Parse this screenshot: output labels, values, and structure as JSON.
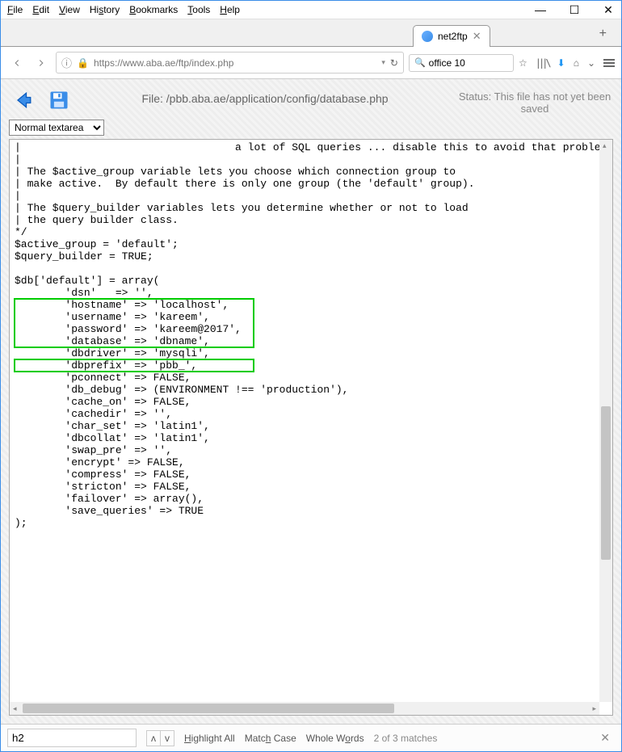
{
  "menu": {
    "file": "File",
    "edit": "Edit",
    "view": "View",
    "history": "History",
    "bookmarks": "Bookmarks",
    "tools": "Tools",
    "help": "Help"
  },
  "tab": {
    "title": "net2ftp"
  },
  "url": {
    "value": "https://www.aba.ae/ftp/index.php"
  },
  "search": {
    "value": "office 10"
  },
  "header": {
    "file_label": "File: /pbb.aba.ae/application/config/database.php",
    "status": "Status: This file has not yet been saved"
  },
  "editor": {
    "mode": "Normal textarea",
    "lines": {
      "c0": "|                                  a lot of SQL queries ... disable this to avoid that problem.",
      "c1": "|",
      "c2": "| The $active_group variable lets you choose which connection group to",
      "c3": "| make active.  By default there is only one group (the 'default' group).",
      "c4": "|",
      "c5": "| The $query_builder variables lets you determine whether or not to load",
      "c6": "| the query builder class.",
      "c7": "*/",
      "c8": "$active_group = 'default';",
      "c9": "$query_builder = TRUE;",
      "c10": "",
      "c11": "$db['default'] = array(",
      "c12": "        'dsn'   => '',",
      "h1": "        'hostname' => 'localhost',    ",
      "h2": "        'username' => 'kareem',       ",
      "h3": "        'password' => 'kareem@2017',  ",
      "h4": "        'database' => 'dbname',       ",
      "c13": "        'dbdriver' => 'mysqli',",
      "h5": "        'dbprefix' => 'pbb_',         ",
      "c14": "        'pconnect' => FALSE,",
      "c15": "        'db_debug' => (ENVIRONMENT !== 'production'),",
      "c16": "        'cache_on' => FALSE,",
      "c17": "        'cachedir' => '',",
      "c18": "        'char_set' => 'latin1',",
      "c19": "        'dbcollat' => 'latin1',",
      "c20": "        'swap_pre' => '',",
      "c21": "        'encrypt' => FALSE,",
      "c22": "        'compress' => FALSE,",
      "c23": "        'stricton' => FALSE,",
      "c24": "        'failover' => array(),",
      "c25": "        'save_queries' => TRUE",
      "c26": ");"
    }
  },
  "find": {
    "value": "h2",
    "highlight": "Highlight All",
    "matchcase": "Match Case",
    "wholewords": "Whole Words",
    "matches": "2 of 3 matches"
  }
}
